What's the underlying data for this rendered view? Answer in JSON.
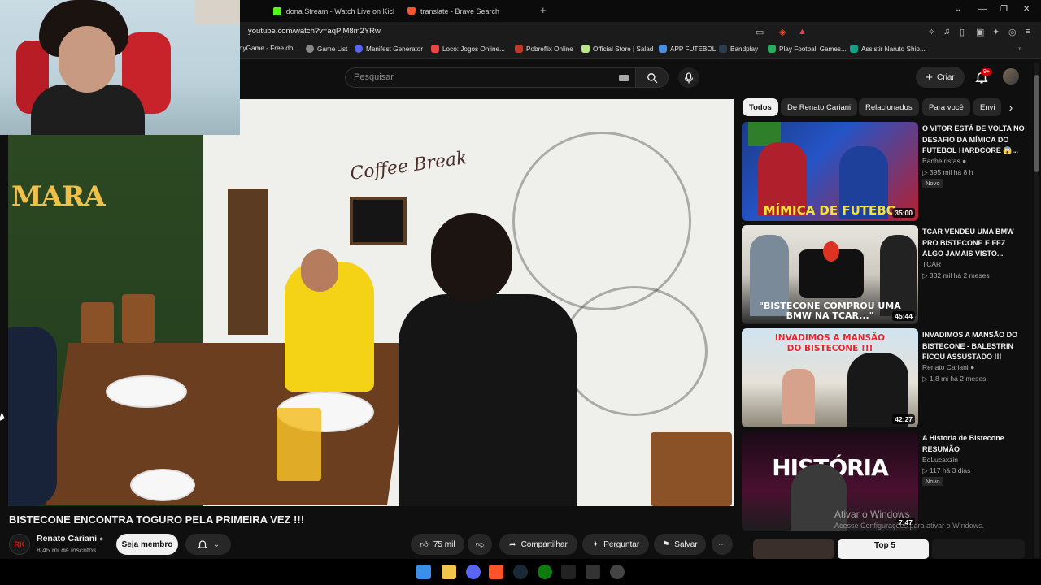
{
  "browser": {
    "tabs": [
      {
        "title": "dona Stream - Watch Live on Kick",
        "color": "#53fc18"
      },
      {
        "title": "translate - Brave Search",
        "color": "#fb542b"
      }
    ],
    "new_tab": "+",
    "url": "youtube.com/watch?v=aqPiM8m2YRw",
    "bookmarks": [
      {
        "label": "nyGame - Free do...",
        "color": "#444"
      },
      {
        "label": "Game List",
        "color": "#888"
      },
      {
        "label": "Manifest Generator",
        "color": "#5865f2"
      },
      {
        "label": "Loco: Jogos Online...",
        "color": "#e84545"
      },
      {
        "label": "Pobreflix Online",
        "color": "#c0392b"
      },
      {
        "label": "Official Store | Salad",
        "color": "#b8e986"
      },
      {
        "label": "APP FUTEBOL",
        "color": "#4a90e2"
      },
      {
        "label": "Bandplay",
        "color": "#2c3e50"
      },
      {
        "label": "Play Football Games...",
        "color": "#27ae60"
      },
      {
        "label": "Assistir Naruto Ship...",
        "color": "#16a085"
      }
    ]
  },
  "youtube": {
    "search_placeholder": "Pesquisar",
    "create_label": "Criar",
    "notif_count": "9+"
  },
  "video": {
    "title": "BISTECONE ENCONTRA TOGURO PELA PRIMEIRA VEZ !!!",
    "channel": "Renato Cariani",
    "subscribers": "8,45 mi de inscritos",
    "join_label": "Seja membro",
    "likes": "75 mil",
    "share_label": "Compartilhar",
    "ask_label": "Perguntar",
    "save_label": "Salvar",
    "scene_text": {
      "sign": "MARA",
      "coffee": "Coffee Break"
    }
  },
  "chips": [
    "Todos",
    "De Renato Cariani",
    "Relacionados",
    "Para você",
    "Envi"
  ],
  "recommendations": [
    {
      "title": "O VITOR ESTÁ DE VOLTA NO DESAFIO DA MÍMICA DO FUTEBOL HARDCORE 😱...",
      "channel": "Banheiristas",
      "verified": true,
      "meta": "395 mil  há 8 h",
      "badge": "Novo",
      "duration": "35:00",
      "thumb_caption": "MÍMICA DE FUTEBO"
    },
    {
      "title": "TCAR VENDEU UMA BMW PRO BISTECONE E FEZ ALGO JAMAIS VISTO...",
      "channel": "TCAR",
      "verified": false,
      "meta": "332 mil  há 2 meses",
      "badge": "",
      "duration": "45:44",
      "thumb_caption": "\"BISTECONE COMPROU UMA BMW NA TCAR...\""
    },
    {
      "title": "INVADIMOS A MANSÃO DO BISTECONE - BALESTRIN FICOU ASSUSTADO !!!",
      "channel": "Renato Cariani",
      "verified": true,
      "meta": "1,8 mi  há 2 meses",
      "badge": "",
      "duration": "42:27",
      "thumb_caption": "INVADIMOS A MANSÃO DO BISTECONE !!!"
    },
    {
      "title": "A Historia de Bistecone RESUMÃO",
      "channel": "EoLucaxzin",
      "verified": false,
      "meta": "117  há 3 dias",
      "badge": "Novo",
      "duration": "7:47",
      "thumb_caption": "HISTÓRIA"
    }
  ],
  "row2_thumbs": [
    "Top 5"
  ],
  "windows_watermark": {
    "line1": "Ativar o Windows",
    "line2": "Acesse Configurações para ativar o Windows."
  }
}
